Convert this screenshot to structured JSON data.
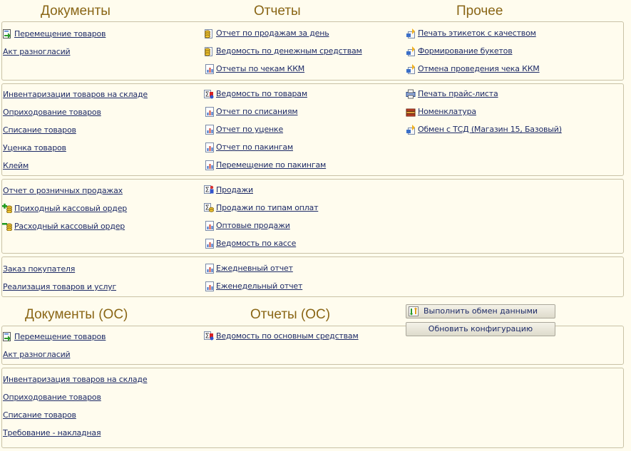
{
  "headers": {
    "documents": "Документы",
    "reports": "Отчеты",
    "other": "Прочее",
    "documents_os": "Документы (ОС)",
    "reports_os": "Отчеты (ОС)"
  },
  "panel1": {
    "documents": [
      "Перемещение товаров",
      "Акт разногласий"
    ],
    "reports": [
      "Отчет по продажам за день",
      "Ведомость по денежным средствам",
      "Отчеты по чекам ККМ"
    ],
    "other": [
      "Печать этикеток с качеством",
      "Формирование букетов",
      "Отмена проведения чека ККМ"
    ]
  },
  "panel2": {
    "documents": [
      "Инвентаризации товаров на складе",
      "Оприходование товаров",
      "Списание товаров",
      "Уценка товаров",
      "Клейм"
    ],
    "reports": [
      "Ведомость по товарам",
      "Отчет по списаниям",
      "Отчет по уценке",
      "Отчет по пакингам",
      "Перемещение по пакингам"
    ],
    "other": [
      "Печать прайс-листа",
      "Номенклатура",
      "Обмен с ТСД (Магазин 15, Базовый)"
    ]
  },
  "panel3": {
    "documents": [
      "Отчет о розничных продажах",
      "Приходный кассовый ордер",
      "Расходный кассовый ордер"
    ],
    "reports": [
      "Продажи",
      "Продажи по типам оплат",
      "Оптовые продажи",
      "Ведомость по кассе"
    ]
  },
  "panel4": {
    "documents": [
      "Заказ покупателя",
      "Реализация товаров и услуг"
    ],
    "reports": [
      "Ежедневный отчет",
      "Еженедельный отчет"
    ]
  },
  "buttons": {
    "exchange": "Выполнить обмен данными",
    "update": "Обновить конфигурацию"
  },
  "panel5": {
    "documents": [
      "Перемещение товаров",
      "Акт разногласий"
    ],
    "reports": [
      "Ведомость по основным средствам"
    ]
  },
  "panel6": {
    "documents": [
      "Инвентаризация товаров на складе",
      "Оприходование товаров",
      "Списание товаров",
      "Требование - накладная"
    ]
  },
  "colors": {
    "header": "#8a6616",
    "link": "#1d2a66",
    "background": "#fffcee",
    "border": "#c9c2a6"
  }
}
